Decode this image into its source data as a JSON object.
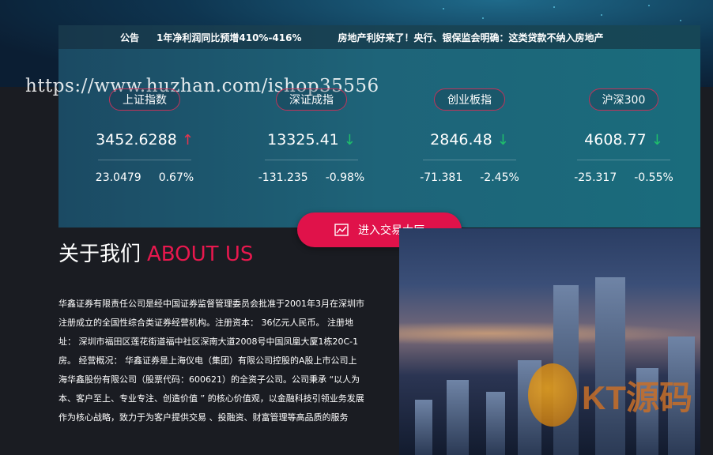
{
  "notice": {
    "label": "公告",
    "items": [
      "1年净利润同比预增410%-416%",
      "房地产利好来了！央行、银保监会明确：这类贷款不纳入房地产"
    ]
  },
  "watermark": "https://www.huzhan.com/ishop35556",
  "indices": [
    {
      "name": "上证指数",
      "value": "3452.6288",
      "trend": "up",
      "change": "23.0479",
      "percent": "0.67%"
    },
    {
      "name": "深证成指",
      "value": "13325.41",
      "trend": "down",
      "change": "-131.235",
      "percent": "-0.98%"
    },
    {
      "name": "创业板指",
      "value": "2846.48",
      "trend": "down",
      "change": "-71.381",
      "percent": "-2.45%"
    },
    {
      "name": "沪深300",
      "value": "4608.77",
      "trend": "down",
      "change": "-25.317",
      "percent": "-0.55%"
    }
  ],
  "trade_button": {
    "label": "进入交易大厅",
    "icon": "chart-line-icon"
  },
  "about": {
    "title_cn": "关于我们",
    "title_en": "ABOUT US",
    "text": "华鑫证券有限责任公司是经中国证券监督管理委员会批准于2001年3月在深圳市注册成立的全国性综合类证券经营机构。注册资本： 36亿元人民币。 注册地址： 深圳市福田区莲花街道福中社区深南大道2008号中国凤凰大厦1栋20C-1房。 经营概况： 华鑫证券是上海仪电（集团）有限公司控股的A股上市公司上海华鑫股份有限公司（股票代码：600621）的全资子公司。公司秉承 “以人为本、客户至上、专业专注、创造价值 ” 的核心价值观，以金融科技引领业务发展作为核心战略，致力于为客户提供交易 、投融资、财富管理等高品质的服务"
  },
  "logo": {
    "text": "KT源码",
    "sub": ""
  },
  "colors": {
    "accent": "#e0124a",
    "up": "#e8344e",
    "down": "#1fbf6b"
  }
}
